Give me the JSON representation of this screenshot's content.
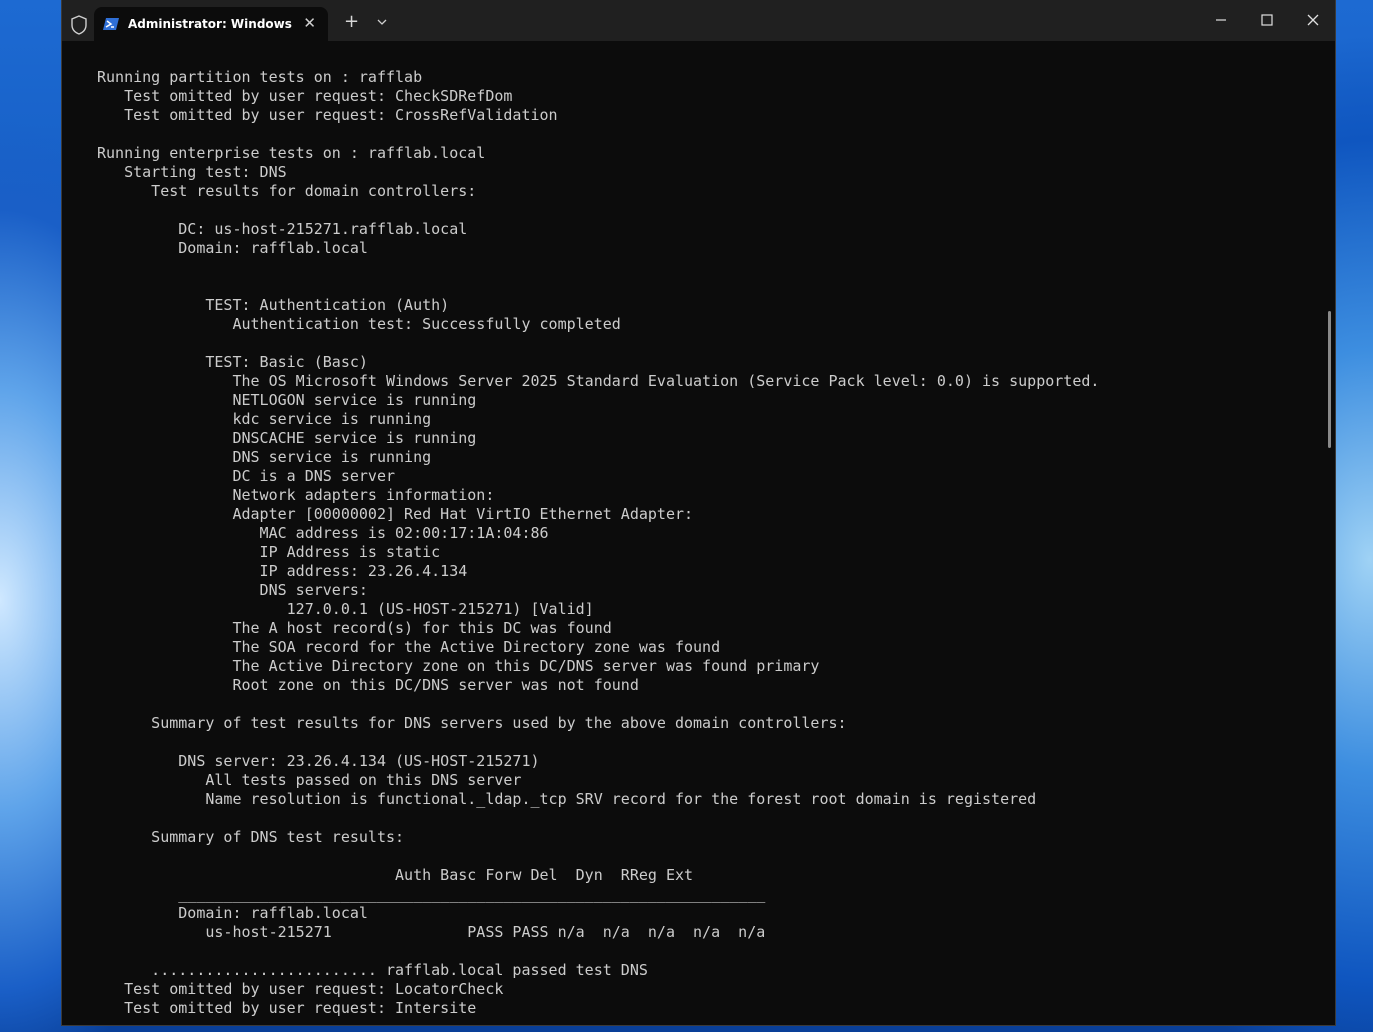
{
  "tab": {
    "title": "Administrator: Windows PowerShell",
    "icon": "powershell-icon",
    "close_glyph": "✕"
  },
  "titlebar": {
    "new_tab_glyph": "+",
    "icons": [
      "shield-icon",
      "chevron-down-icon",
      "minimize-icon",
      "maximize-icon",
      "close-icon"
    ]
  },
  "terminal": {
    "lines": [
      "Running partition tests on : rafflab",
      "   Test omitted by user request: CheckSDRefDom",
      "   Test omitted by user request: CrossRefValidation",
      "",
      "Running enterprise tests on : rafflab.local",
      "   Starting test: DNS",
      "      Test results for domain controllers:",
      "",
      "         DC: us-host-215271.rafflab.local",
      "         Domain: rafflab.local",
      "",
      "",
      "            TEST: Authentication (Auth)",
      "               Authentication test: Successfully completed",
      "",
      "            TEST: Basic (Basc)",
      "               The OS Microsoft Windows Server 2025 Standard Evaluation (Service Pack level: 0.0) is supported.",
      "               NETLOGON service is running",
      "               kdc service is running",
      "               DNSCACHE service is running",
      "               DNS service is running",
      "               DC is a DNS server",
      "               Network adapters information:",
      "               Adapter [00000002] Red Hat VirtIO Ethernet Adapter:",
      "                  MAC address is 02:00:17:1A:04:86",
      "                  IP Address is static",
      "                  IP address: 23.26.4.134",
      "                  DNS servers:",
      "                     127.0.0.1 (US-HOST-215271) [Valid]",
      "               The A host record(s) for this DC was found",
      "               The SOA record for the Active Directory zone was found",
      "               The Active Directory zone on this DC/DNS server was found primary",
      "               Root zone on this DC/DNS server was not found",
      "",
      "      Summary of test results for DNS servers used by the above domain controllers:",
      "",
      "         DNS server: 23.26.4.134 (US-HOST-215271)",
      "            All tests passed on this DNS server",
      "            Name resolution is functional._ldap._tcp SRV record for the forest root domain is registered",
      "",
      "      Summary of DNS test results:",
      "",
      "                                 Auth Basc Forw Del  Dyn  RReg Ext",
      "         _________________________________________________________________",
      "         Domain: rafflab.local",
      "            us-host-215271               PASS PASS n/a  n/a  n/a  n/a  n/a",
      "",
      "      ......................... rafflab.local passed test DNS",
      "   Test omitted by user request: LocatorCheck",
      "   Test omitted by user request: Intersite"
    ]
  }
}
